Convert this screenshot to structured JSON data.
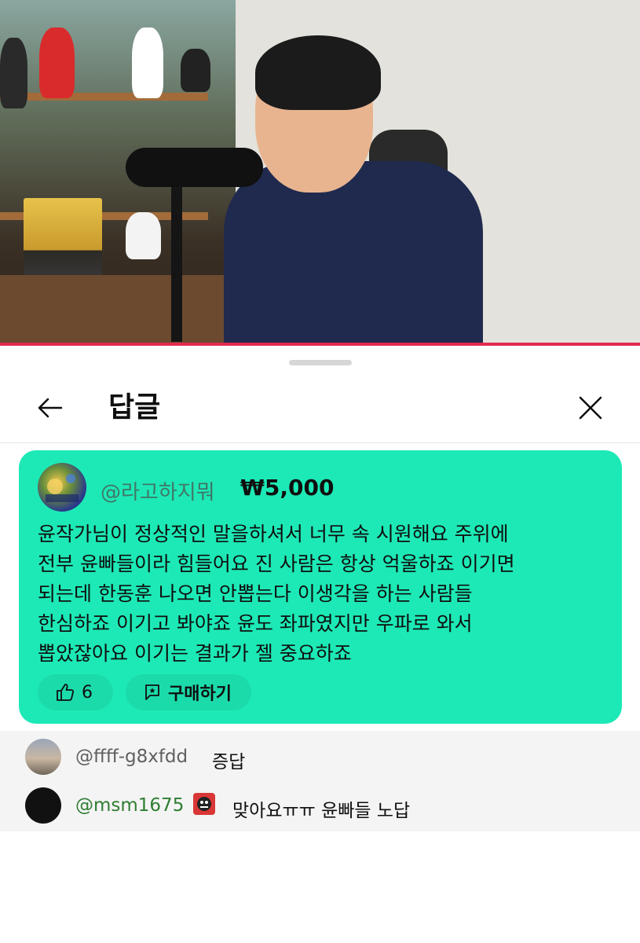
{
  "header": {
    "title": "답글",
    "back_icon": "arrow-left-icon",
    "close_icon": "close-icon"
  },
  "super_chat": {
    "author": "@라고하지뭐",
    "amount": "₩5,000",
    "text": "윤작가님이 정상적인 말을하셔서 너무 속 시원해요 주위에\n전부 윤빠들이라 힘들어요 진 사람은 항상 억울하죠 이기면\n되는데 한동훈 나오면 안뽑는다 이생각을 하는 사람들\n한심하죠 이기고 봐야죠 윤도 좌파였지만 우파로 와서\n뽑았잖아요 이기는 결과가 젤 중요하죠",
    "like_count": "6",
    "buy_label": "구매하기",
    "colors": {
      "background": "#1de9b6",
      "author": "#3f7767"
    }
  },
  "replies": [
    {
      "author": "@ffff-g8xfdd",
      "text": "증답",
      "author_color": "#606060"
    },
    {
      "author": "@msm1675",
      "text": "맞아요ㅠㅠ 윤빠들 노답",
      "author_color": "#2e7d32",
      "badge_icon": "member-badge-icon"
    }
  ],
  "colors": {
    "progress_bar": "#e22a4d"
  }
}
